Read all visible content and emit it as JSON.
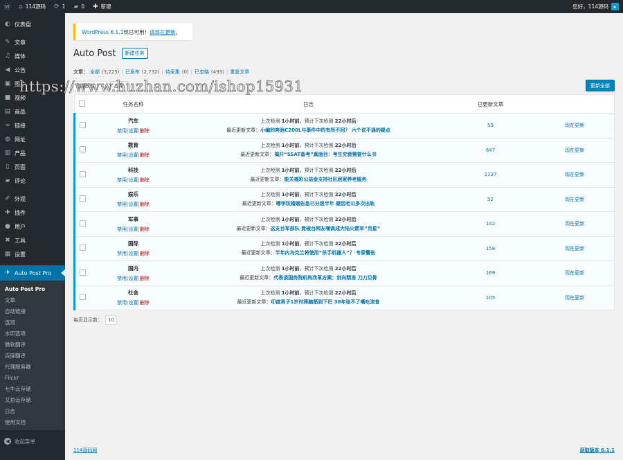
{
  "adminbar": {
    "site_name": "114源码",
    "updates_count": "1",
    "comments_count": "0",
    "new_label": "新建",
    "greeting": "您好，114源码"
  },
  "sidebar": {
    "items": [
      {
        "icon": "dashboard-icon",
        "glyph": "◐",
        "label": "仪表盘"
      },
      {
        "icon": "pin-icon",
        "glyph": "✎",
        "label": "文章"
      },
      {
        "icon": "media-icon",
        "glyph": "♫",
        "label": "媒体"
      },
      {
        "icon": "megaphone-icon",
        "glyph": "◀",
        "label": "公告"
      },
      {
        "icon": "image-icon",
        "glyph": "▣",
        "label": "图片"
      },
      {
        "icon": "video-icon",
        "glyph": "■",
        "label": "视频"
      },
      {
        "icon": "cart-icon",
        "glyph": "▤",
        "label": "商品"
      },
      {
        "icon": "link-icon",
        "glyph": "∞",
        "label": "链接"
      },
      {
        "icon": "globe-icon",
        "glyph": "◍",
        "label": "网址"
      },
      {
        "icon": "product-icon",
        "glyph": "▥",
        "label": "产品"
      },
      {
        "icon": "page-icon",
        "glyph": "▯",
        "label": "页面"
      },
      {
        "icon": "comment-icon",
        "glyph": "▰",
        "label": "评论"
      },
      {
        "icon": "appearance-icon",
        "glyph": "✐",
        "label": "外观"
      },
      {
        "icon": "plugin-icon",
        "glyph": "✚",
        "label": "插件"
      },
      {
        "icon": "user-icon",
        "glyph": "●",
        "label": "用户"
      },
      {
        "icon": "tools-icon",
        "glyph": "✖",
        "label": "工具"
      },
      {
        "icon": "settings-icon",
        "glyph": "▦",
        "label": "设置"
      }
    ],
    "current": {
      "icon": "autopost-icon",
      "glyph": "✈",
      "label": "Auto Post Pro"
    },
    "submenu": [
      "Auto Post Pro",
      "文章",
      "自动链接",
      "选项",
      "水印选项",
      "微软翻译",
      "百度翻译",
      "代理服务器",
      "Flickr",
      "七牛云存储",
      "又拍云存储",
      "日志",
      "使用文档"
    ],
    "collapse_label": "收起菜单"
  },
  "notice": {
    "prefix": "WordPress 6.1.1",
    "middle": "现已可用！",
    "link": "请现在更新",
    "suffix": "。"
  },
  "page": {
    "title": "Auto Post",
    "add_new": "新建任务"
  },
  "filters": {
    "label": "文章：",
    "items": [
      {
        "name": "全部",
        "count": "(3,225)"
      },
      {
        "name": "已发布",
        "count": "(2,732)"
      },
      {
        "name": "待采集",
        "count": "(0)"
      },
      {
        "name": "已忽略",
        "count": "(493)"
      },
      {
        "name": "重复文章",
        "count": ""
      }
    ]
  },
  "tablenav": {
    "bulk_label": "批量操作",
    "apply_label": "应用",
    "update_all_label": "更新全部"
  },
  "watermark": "https://www.huzhan.com/ishop15931",
  "table": {
    "headers": {
      "name": "任务名称",
      "log": "日志",
      "count": "已更新文章"
    },
    "actions": {
      "disable": "禁用",
      "settings": "设置",
      "delete": "删除",
      "sep": "|"
    },
    "log_text": {
      "last_check": "上次检测",
      "last_value": "1小时前",
      "next_check": "预计下次检测",
      "next_value": "22小时后",
      "recent": "最近更新文章："
    },
    "update_now": "现在更新",
    "rows": [
      {
        "name": "汽车",
        "article": "小编的奔驰C200L与事件中的有所不同？ 六个说不通的疑点",
        "count": "59"
      },
      {
        "name": "教育",
        "article": "揭开“SSAT备考”真面目：考生究竟需要什么书",
        "count": "647"
      },
      {
        "name": "科技",
        "article": "能关福彩公益金支持社区居家养老服务",
        "count": "1137"
      },
      {
        "name": "娱乐",
        "article": "嘟李玟婚姻告急已分居半年 疑因老公多次出轨",
        "count": "52"
      },
      {
        "name": "军事",
        "article": "这支台军部队 竟被台网友嘲讽成大陆火箭军“克星”",
        "count": "142"
      },
      {
        "name": "国际",
        "article": "半年内乌克兰将使用“杀手机器人”？ 专家警告",
        "count": "158"
      },
      {
        "name": "国内",
        "article": "代表谈国务院机构改革方案：剑向精准 刀刀见骨",
        "count": "169"
      },
      {
        "name": "社会",
        "article": "印度男子1岁时摔脑筋到下巴 38年张不了嘴吃流食",
        "count": "105"
      }
    ]
  },
  "per_page": {
    "label": "每页显示数：",
    "value": "10"
  },
  "footer": {
    "left": "114源码网",
    "right": "获取版本 6.1.1"
  }
}
